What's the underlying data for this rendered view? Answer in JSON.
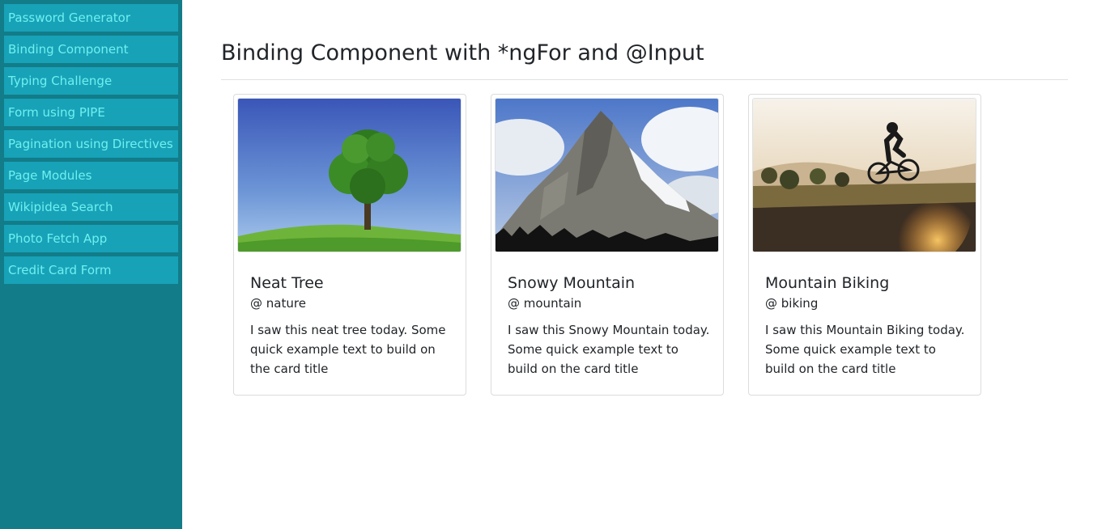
{
  "sidebar": {
    "items": [
      {
        "label": "Password Generator"
      },
      {
        "label": "Binding Component"
      },
      {
        "label": "Typing Challenge"
      },
      {
        "label": "Form using PIPE"
      },
      {
        "label": "Pagination using Directives"
      },
      {
        "label": "Page Modules"
      },
      {
        "label": "Wikipidea Search"
      },
      {
        "label": "Photo Fetch App"
      },
      {
        "label": "Credit Card Form"
      }
    ]
  },
  "main": {
    "title": "Binding Component with *ngFor and @Input"
  },
  "cards": [
    {
      "title": "Neat Tree",
      "handle": "@ nature",
      "text": "I saw this neat tree today. Some quick example text to build on the card title",
      "image_icon": "tree-photo"
    },
    {
      "title": "Snowy Mountain",
      "handle": "@ mountain",
      "text": "I saw this Snowy Mountain today. Some quick example text to build on the card title",
      "image_icon": "mountain-photo"
    },
    {
      "title": "Mountain Biking",
      "handle": "@ biking",
      "text": "I saw this Mountain Biking today. Some quick example text to build on the card title",
      "image_icon": "biking-photo"
    }
  ],
  "colors": {
    "sidebar_bg": "#127c88",
    "sidebar_item_bg": "#17a2b8",
    "sidebar_item_text": "#6ff0ef"
  }
}
